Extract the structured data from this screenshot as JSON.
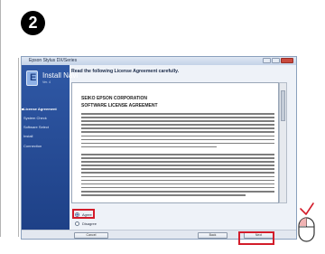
{
  "step_number": "2",
  "window": {
    "title": "Epson Stylus DX/Series",
    "app_name": "Install Navi",
    "app_version": "Ver. 4",
    "accent_color": "#2f58a5"
  },
  "sidebar": {
    "items": [
      {
        "label": "License Agreement",
        "active": true
      },
      {
        "label": "System Check",
        "active": false
      },
      {
        "label": "Software Select",
        "active": false
      },
      {
        "label": "Install",
        "active": false
      },
      {
        "label": "Connection",
        "active": false
      }
    ]
  },
  "content": {
    "heading": "Read the following License Agreement carefully.",
    "license_company": "SEIKO EPSON CORPORATION",
    "license_title": "SOFTWARE LICENSE AGREEMENT"
  },
  "options": {
    "agree": "Agree",
    "disagree": "Disagree",
    "selected": "Agree"
  },
  "buttons": {
    "cancel": "Cancel",
    "back": "Back",
    "next": "Next"
  },
  "highlight_color": "#d31c2a"
}
